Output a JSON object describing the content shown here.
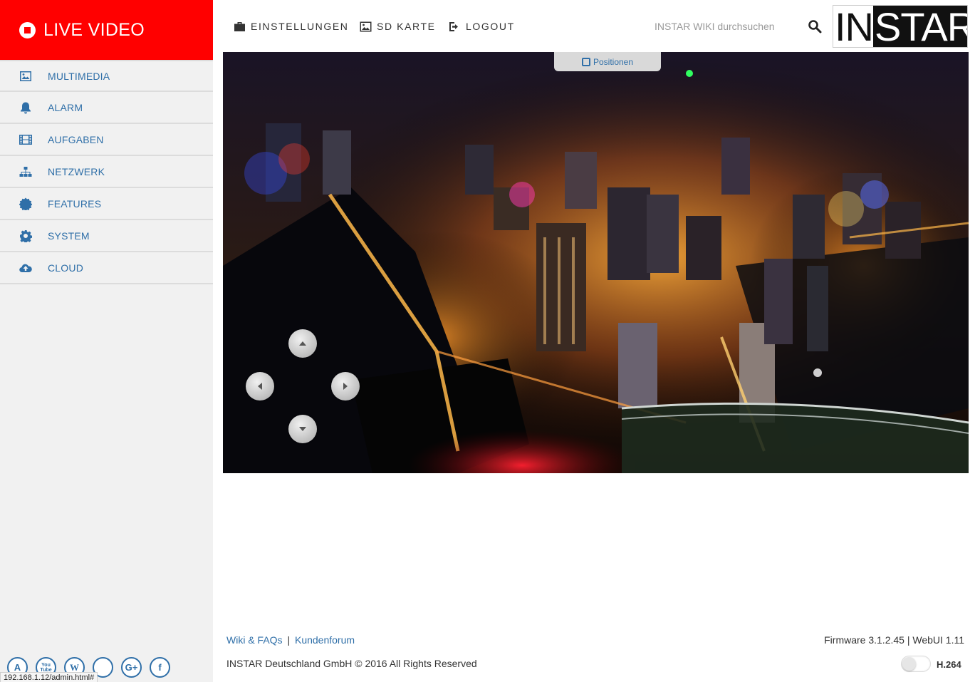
{
  "sidebar": {
    "brand_label": "LIVE VIDEO",
    "items": [
      {
        "label": "MULTIMEDIA",
        "icon": "image-icon"
      },
      {
        "label": "ALARM",
        "icon": "bell-icon"
      },
      {
        "label": "AUFGABEN",
        "icon": "film-icon"
      },
      {
        "label": "NETZWERK",
        "icon": "sitemap-icon"
      },
      {
        "label": "FEATURES",
        "icon": "certificate-icon"
      },
      {
        "label": "SYSTEM",
        "icon": "gear-icon"
      },
      {
        "label": "CLOUD",
        "icon": "cloud-upload-icon"
      }
    ],
    "socials": [
      "A",
      "You Tube",
      "W",
      "twitter",
      "G+",
      "f"
    ],
    "status_url": "192.168.1.12/admin.html#"
  },
  "topnav": {
    "settings_label": "EINSTELLUNGEN",
    "sdcard_label": "SD KARTE",
    "logout_label": "LOGOUT",
    "search_placeholder": "INSTAR WIKI durchsuchen",
    "logo_left": "IN",
    "logo_right": "STAR"
  },
  "video": {
    "positions_label": "Positionen"
  },
  "footer": {
    "wiki_link": "Wiki & FAQs",
    "separator": "|",
    "forum_link": "Kundenforum",
    "copyright": "INSTAR Deutschland GmbH © 2016 All Rights Reserved",
    "firmware": "Firmware 3.1.2.45 | WebUI 1.11",
    "codec_label": "H.264"
  },
  "colors": {
    "brand": "#ff0000",
    "accent": "#2f6fa8",
    "sidebar_bg": "#f1f1f1"
  }
}
